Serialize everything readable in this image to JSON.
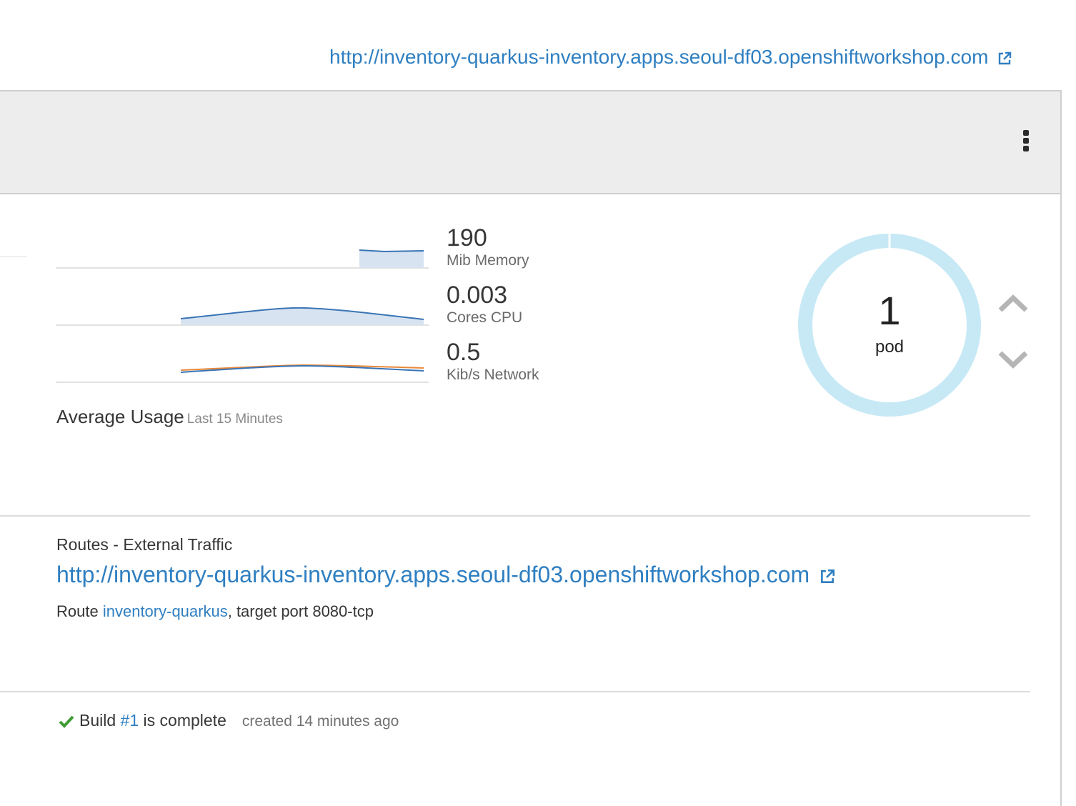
{
  "top_route_url": "http://inventory-quarkus-inventory.apps.seoul-df03.openshiftworkshop.com",
  "metrics": [
    {
      "value": "190",
      "label": "Mib Memory"
    },
    {
      "value": "0.003",
      "label": "Cores CPU"
    },
    {
      "value": "0.5",
      "label": "Kib/s Network"
    }
  ],
  "usage": {
    "title": "Average Usage",
    "period": "Last 15 Minutes"
  },
  "pods": {
    "count": "1",
    "label": "pod"
  },
  "routes": {
    "title": "Routes - External Traffic",
    "url": "http://inventory-quarkus-inventory.apps.seoul-df03.openshiftworkshop.com",
    "route_prefix": "Route",
    "route_name": "inventory-quarkus",
    "route_suffix": ", target port 8080-tcp"
  },
  "build": {
    "prefix": "Build",
    "number": "#1",
    "suffix": "is complete",
    "created": "created 14 minutes ago"
  },
  "colors": {
    "link": "#2f7fc1",
    "sparkline_blue": "#3a75b6",
    "sparkline_orange": "#e8883a",
    "donut": "#c7e9f6",
    "success": "#3f9c35"
  }
}
